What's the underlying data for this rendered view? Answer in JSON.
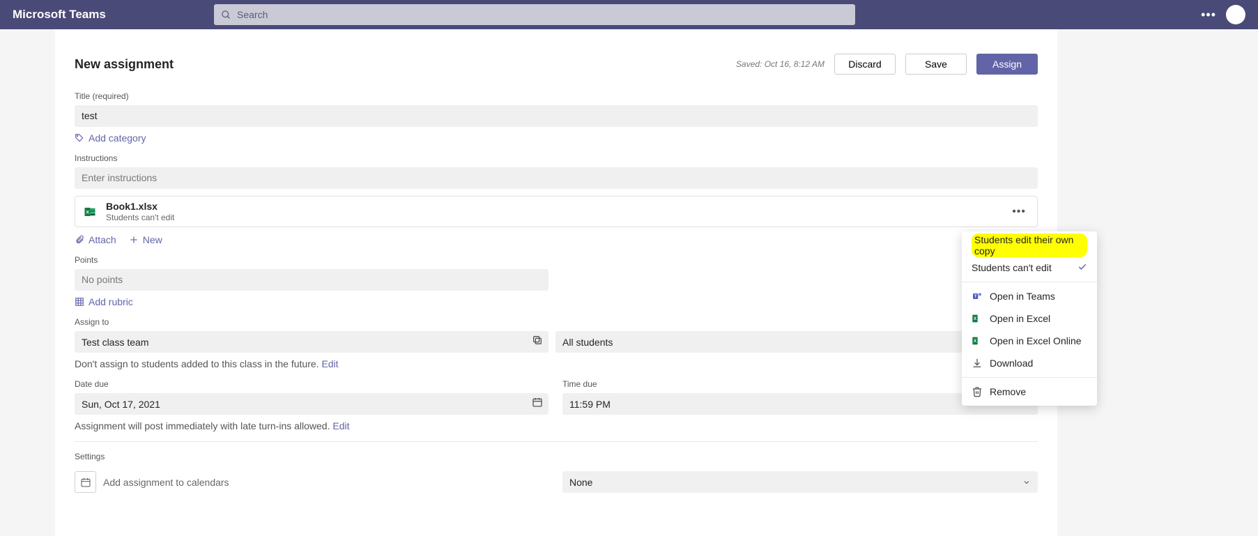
{
  "app": {
    "title": "Microsoft Teams"
  },
  "search": {
    "placeholder": "Search"
  },
  "page": {
    "title": "New assignment",
    "saved": "Saved: Oct 16, 8:12 AM",
    "discard": "Discard",
    "save": "Save",
    "assign": "Assign"
  },
  "title_field": {
    "label": "Title (required)",
    "value": "test"
  },
  "add_category": "Add category",
  "instructions": {
    "label": "Instructions",
    "placeholder": "Enter instructions"
  },
  "attachment": {
    "name": "Book1.xlsx",
    "sub": "Students can't edit"
  },
  "attach_label": "Attach",
  "new_label": "New",
  "points": {
    "label": "Points",
    "value": "No points"
  },
  "add_rubric": "Add rubric",
  "assign_to": {
    "label": "Assign to",
    "team": "Test class team",
    "students": "All students",
    "helper": "Don't assign to students added to this class in the future. ",
    "edit": "Edit"
  },
  "date_due": {
    "label": "Date due",
    "value": "Sun, Oct 17, 2021"
  },
  "time_due": {
    "label": "Time due",
    "value": "11:59 PM"
  },
  "post_helper": "Assignment will post immediately with late turn-ins allowed. ",
  "post_edit": "Edit",
  "settings": {
    "label": "Settings",
    "calendar": "Add assignment to calendars",
    "none": "None"
  },
  "menu": {
    "own_copy": "Students edit their own copy",
    "cant_edit": "Students can't edit",
    "open_teams": "Open in Teams",
    "open_excel": "Open in Excel",
    "open_excel_online": "Open in Excel Online",
    "download": "Download",
    "remove": "Remove"
  }
}
